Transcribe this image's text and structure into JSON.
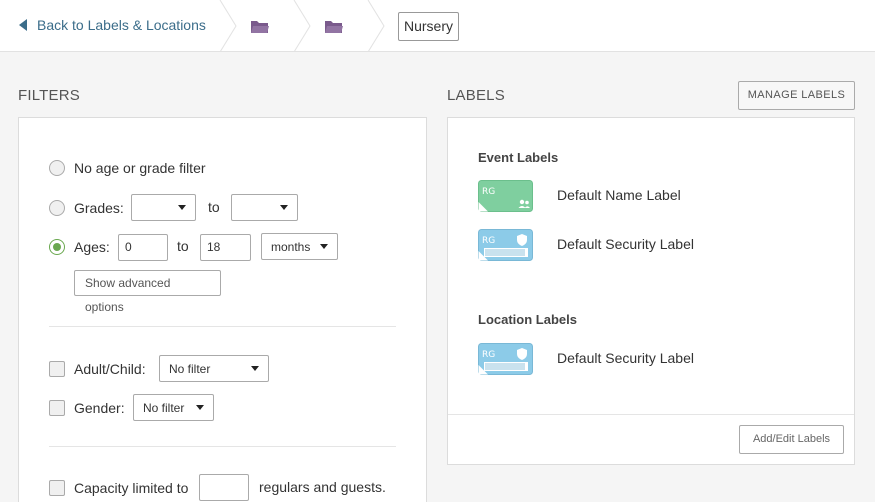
{
  "header": {
    "back_label": "Back to Labels & Locations",
    "current": "Nursery"
  },
  "filters": {
    "title": "FILTERS",
    "no_filter_label": "No age or grade filter",
    "grades_label": "Grades:",
    "to_label": "to",
    "ages_label": "Ages:",
    "age_from": "0",
    "age_to": "18",
    "age_unit": "months",
    "advanced_label": "Show advanced options",
    "adult_child_label": "Adult/Child:",
    "adult_child_value": "No filter",
    "gender_label": "Gender:",
    "gender_value": "No filter",
    "capacity_label": "Capacity limited to",
    "capacity_suffix": "regulars and guests."
  },
  "labels": {
    "title": "LABELS",
    "manage_button": "MANAGE LABELS",
    "event_heading": "Event Labels",
    "event_items": [
      {
        "name": "Default Name Label",
        "icon_text": "RG",
        "icon": "name-label-icon"
      },
      {
        "name": "Default Security Label",
        "icon_text": "RG",
        "icon": "security-label-icon"
      }
    ],
    "location_heading": "Location Labels",
    "location_items": [
      {
        "name": "Default Security Label",
        "icon_text": "RG",
        "icon": "security-label-icon"
      }
    ],
    "add_edit_button": "Add/Edit Labels"
  },
  "colors": {
    "link": "#3b6d8a",
    "folder": "#7a5a8c",
    "radio_on": "#6aa84f",
    "name_label": "#7fcf9f",
    "security_label": "#8ccbe8"
  }
}
